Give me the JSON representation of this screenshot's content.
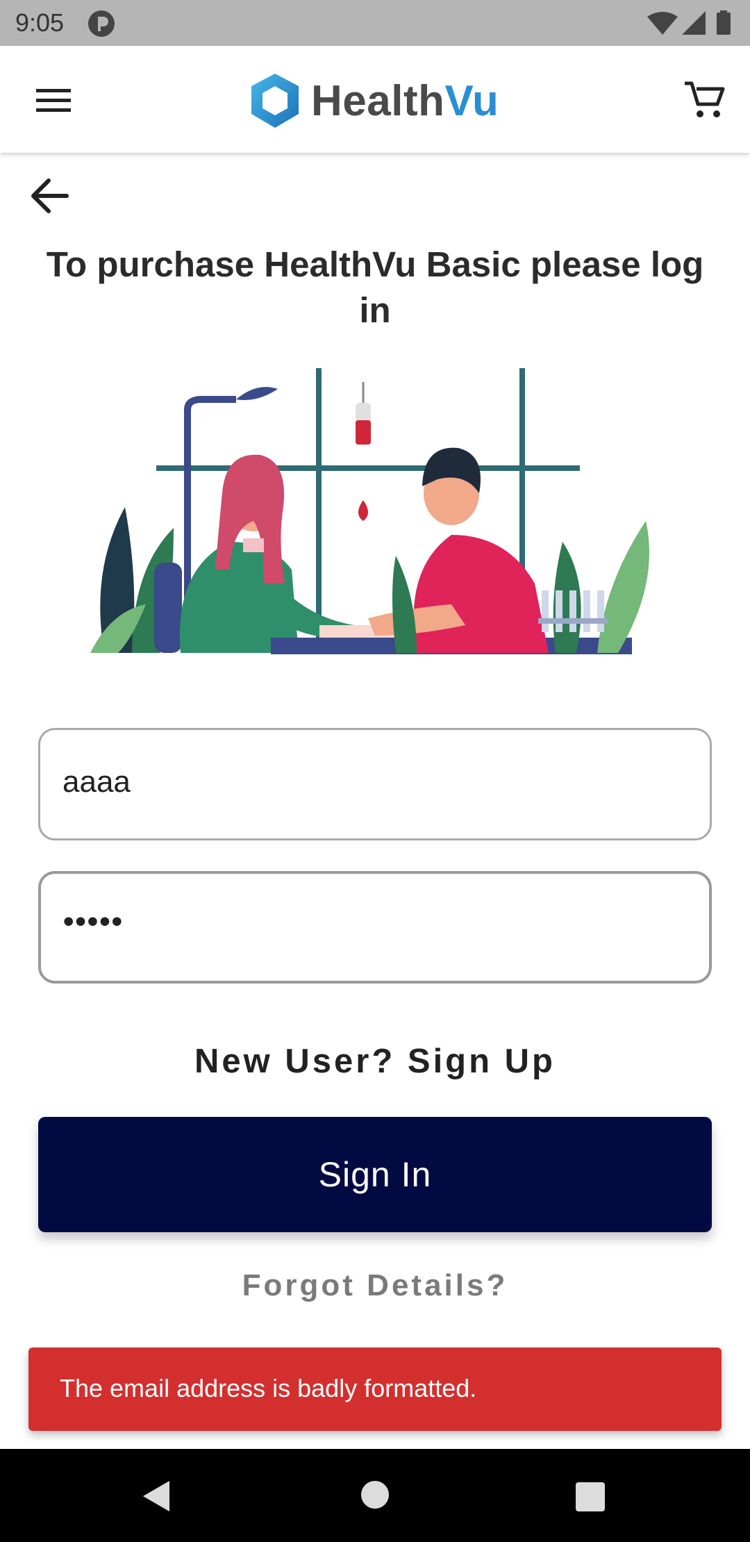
{
  "status_bar": {
    "time": "9:05",
    "icons": [
      "pcloud-icon",
      "wifi-icon",
      "cell-signal-icon",
      "battery-icon"
    ]
  },
  "app_bar": {
    "logo_text_main": "Health",
    "logo_text_accent": "Vu",
    "menu_icon": "hamburger-menu-icon",
    "cart_icon": "shopping-cart-icon"
  },
  "page": {
    "back_icon": "arrow-left-icon",
    "heading": "To purchase HealthVu Basic please log in"
  },
  "form": {
    "email_value": "aaaa",
    "password_value": "•••••"
  },
  "links": {
    "signup": "New User? Sign Up",
    "forgot": "Forgot Details?"
  },
  "buttons": {
    "signin": "Sign In"
  },
  "snackbar": {
    "message": "The email address is badly formatted."
  },
  "colors": {
    "primary_button": "#020a42",
    "error": "#d32f2f",
    "logo_accent": "#2a8fd0"
  }
}
